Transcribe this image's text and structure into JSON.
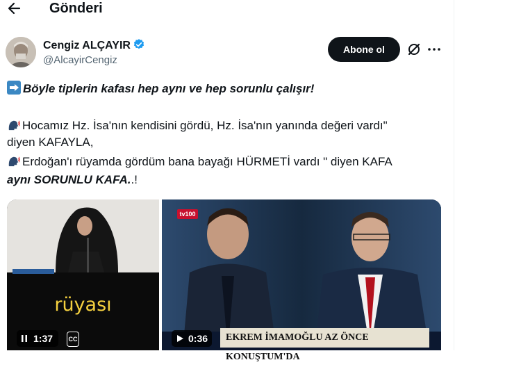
{
  "header": {
    "title": "Gönderi"
  },
  "author": {
    "name": "Cengiz ALÇAYIR",
    "handle": "@AlcayirCengiz",
    "subscribe_label": "Abone ol",
    "verified_color": "#1d9bf0"
  },
  "post": {
    "line1": "Böyle tiplerin kafası hep aynı ve hep sorunlu çalışır!",
    "line2": "Hocamız Hz. İsa'nın kendisini gördü, Hz. İsa'nın yanında değeri vardı\"",
    "line3": "diyen KAFAYLA,",
    "line4": "Erdoğan'ı rüyamda gördüm bana bayağı HÜRMETİ vardı \" diyen KAFA",
    "line5_bold": "aynı SORUNLU KAFA.",
    "line5_end": ".!"
  },
  "media": {
    "video1": {
      "caption": "rüyası",
      "time": "1:37",
      "cc_label": "CC"
    },
    "video2": {
      "time": "0:36",
      "ticker": "EKREM İMAMOĞLU AZ ÖNCE KONUŞTUM'DA",
      "channel_logo": "tv100"
    }
  },
  "icons": {
    "back": "arrow-left-icon",
    "grok": "grok-icon",
    "more": "more-dots-icon",
    "pause": "pause-icon",
    "play": "play-icon"
  }
}
